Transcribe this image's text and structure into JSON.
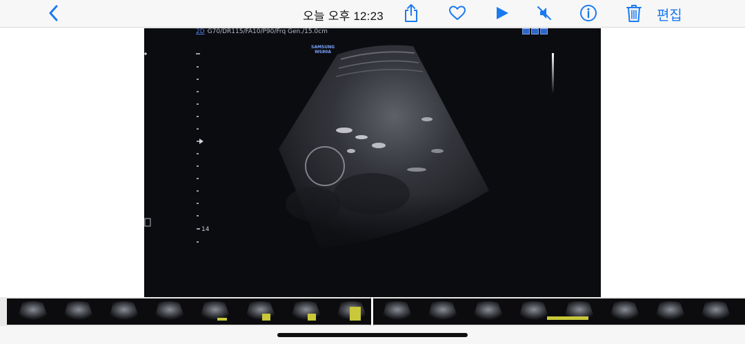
{
  "toolbar": {
    "title": "오늘 오후 12:23",
    "edit_label": "편집"
  },
  "ultrasound": {
    "mode_label": "2D",
    "params": "G70/DR115/FA10/P90/Frq Gen./15.0cm",
    "brand_line1": "SAMSUNG",
    "brand_line2": "WS80A",
    "depth_label": "14"
  },
  "colors": {
    "accent": "#1a7af0",
    "toolbar_bg": "#f7f7f7",
    "image_bg": "#0b0c10",
    "header_text": "#b6bccb",
    "mode_blue": "#4f7fe0"
  },
  "icons": [
    "back-chevron-icon",
    "share-icon",
    "heart-icon",
    "play-icon",
    "mute-icon",
    "info-icon",
    "trash-icon"
  ]
}
